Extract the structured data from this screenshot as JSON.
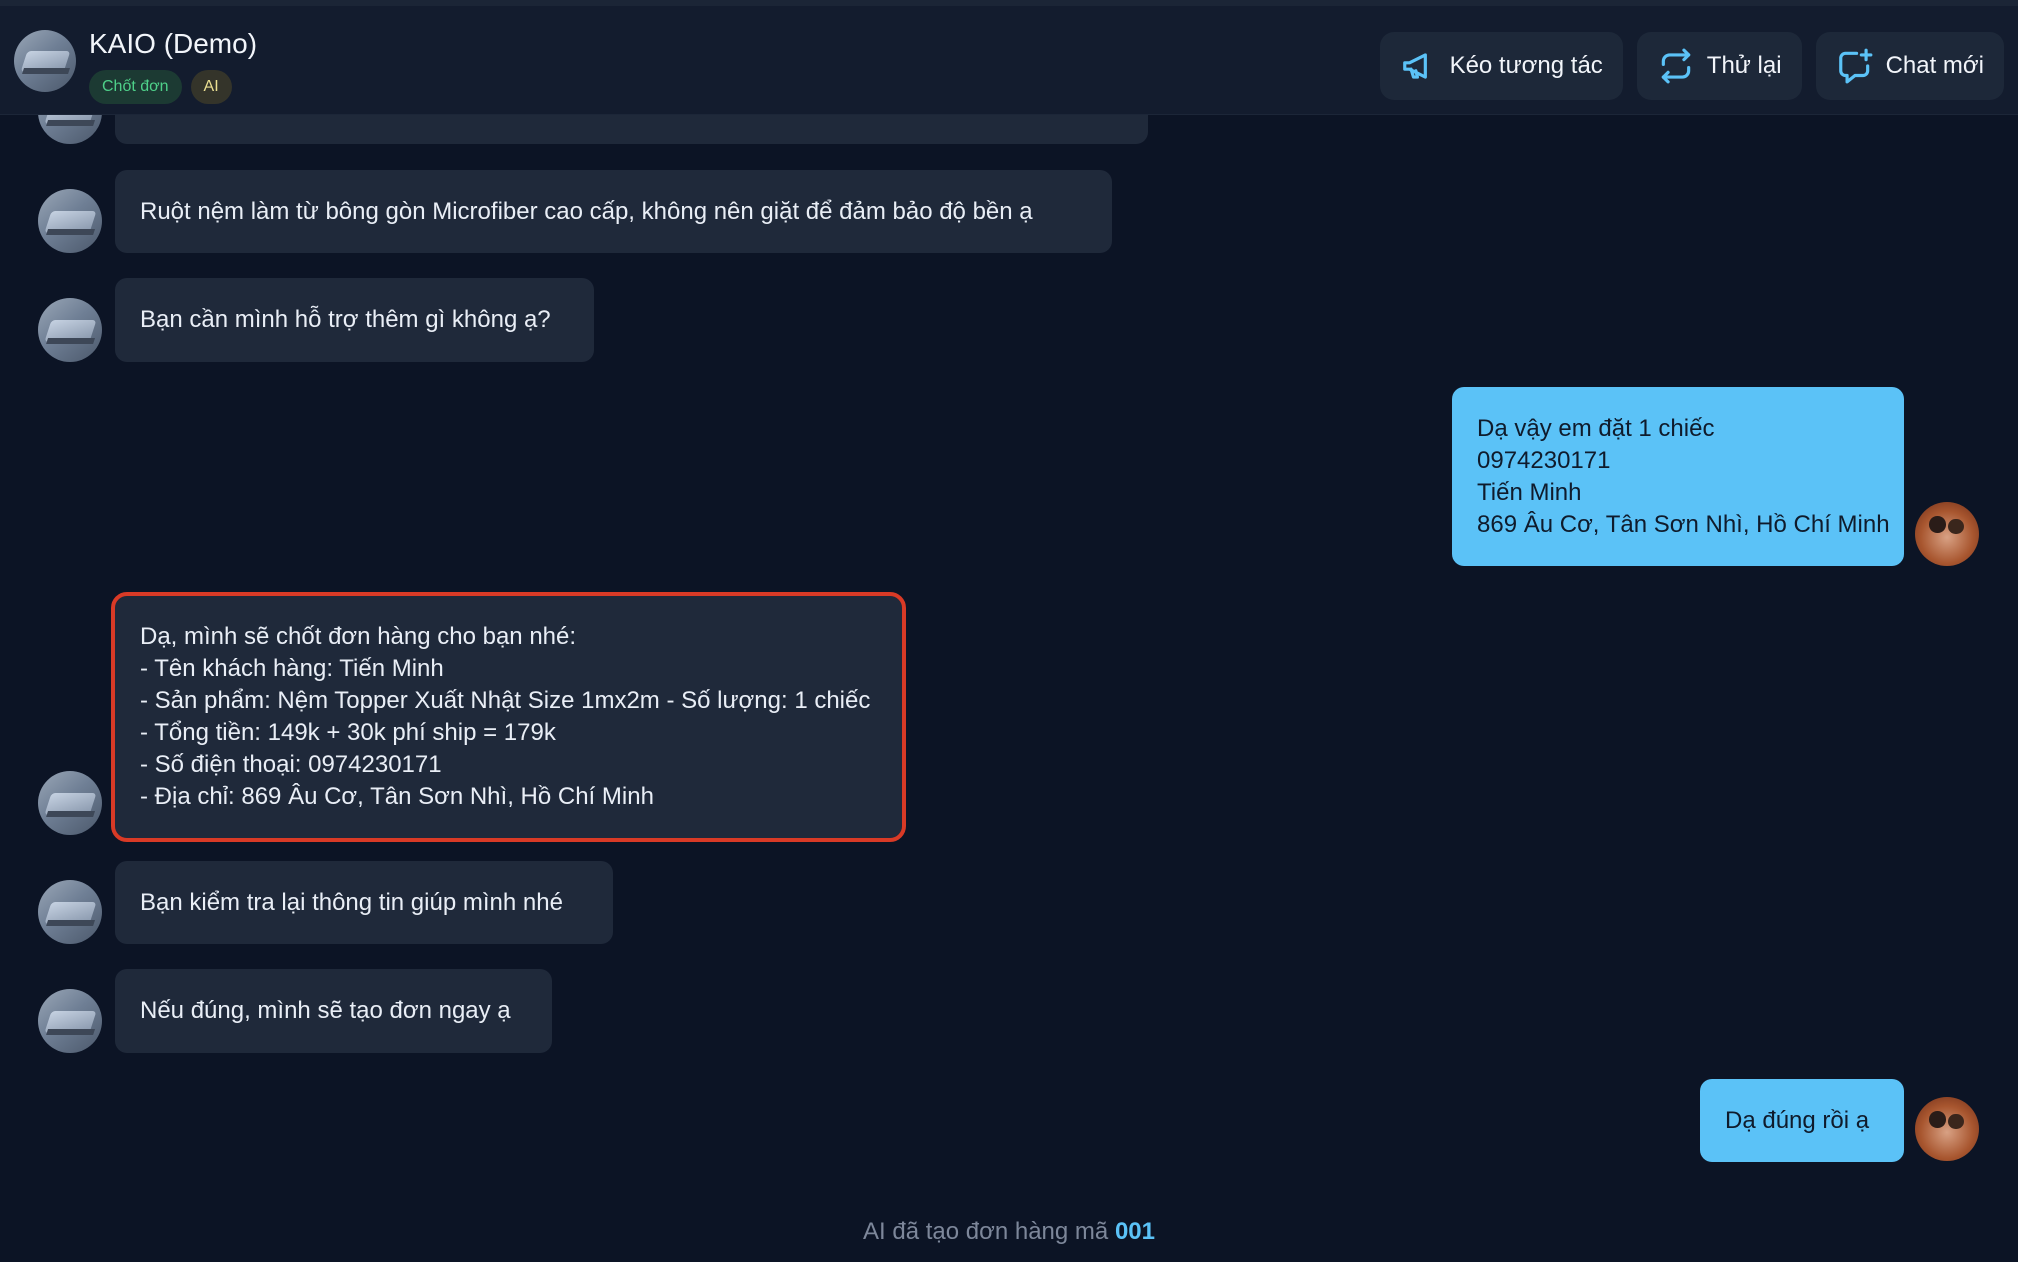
{
  "header": {
    "title": "KAIO (Demo)",
    "badges": [
      "Chốt đơn",
      "AI"
    ],
    "actions": [
      {
        "label": "Kéo tương tác",
        "icon": "megaphone-icon"
      },
      {
        "label": "Thử lại",
        "icon": "retry-icon"
      },
      {
        "label": "Chat mới",
        "icon": "new-chat-icon"
      }
    ]
  },
  "messages": [
    {
      "sender": "bot",
      "text": "Ruột nệm làm từ bông gòn Microfiber cao cấp, không nên giặt để đảm bảo độ bền ạ"
    },
    {
      "sender": "bot",
      "text": "Bạn cần mình hỗ trợ thêm gì không ạ?"
    },
    {
      "sender": "user",
      "lines": [
        "Dạ vậy em đặt 1 chiếc",
        "0974230171",
        "Tiến Minh",
        "869 Âu Cơ, Tân Sơn Nhì, Hồ Chí Minh"
      ]
    },
    {
      "sender": "bot",
      "lines": [
        "Dạ, mình sẽ chốt đơn hàng cho bạn nhé:",
        "- Tên khách hàng: Tiến Minh",
        "- Sản phẩm: Nệm Topper Xuất Nhật Size 1mx2m - Số lượng: 1 chiếc",
        "- Tổng tiền: 149k + 30k phí ship = 179k",
        "- Số điện thoại: 0974230171",
        "- Địa chỉ: 869 Âu Cơ, Tân Sơn Nhì, Hồ Chí Minh"
      ]
    },
    {
      "sender": "bot",
      "text": "Bạn kiểm tra lại thông tin giúp mình nhé"
    },
    {
      "sender": "bot",
      "text": "Nếu đúng, mình sẽ tạo đơn ngay ạ"
    },
    {
      "sender": "user",
      "text": "Dạ đúng rồi ạ"
    }
  ],
  "footer": {
    "text": "AI đã tạo đơn hàng mã",
    "order_code": "001"
  },
  "colors": {
    "background": "#0c1425",
    "bot_bubble": "#1f293a",
    "user_bubble": "#5bc2f7",
    "highlight": "#d93a26",
    "accent": "#5bc2f7"
  }
}
